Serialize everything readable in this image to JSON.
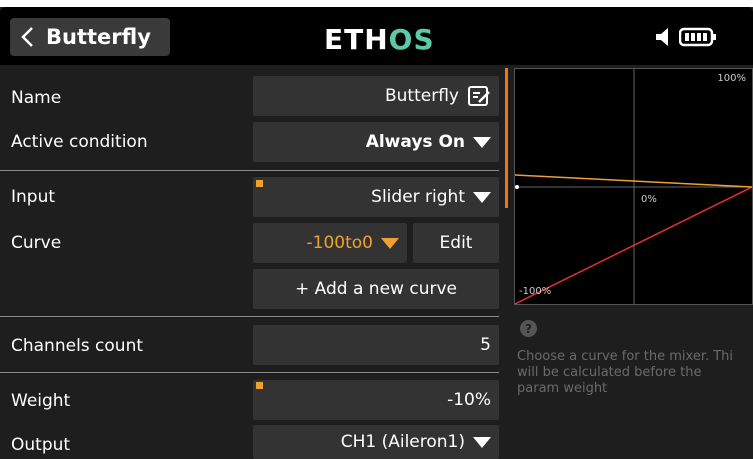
{
  "header": {
    "title": "Butterfly",
    "logo_main": "ETH",
    "logo_accent": "OS"
  },
  "rows": {
    "name": {
      "label": "Name",
      "value": "Butterfly"
    },
    "active_condition": {
      "label": "Active condition",
      "value": "Always On"
    },
    "input": {
      "label": "Input",
      "value": "Slider right"
    },
    "curve": {
      "label": "Curve",
      "value": "-100to0",
      "edit_label": "Edit",
      "add_label": "+ Add a new curve"
    },
    "channels_count": {
      "label": "Channels count",
      "value": "5"
    },
    "weight": {
      "label": "Weight",
      "value": "-10%"
    },
    "output": {
      "label": "Output",
      "value": "CH1 (Aileron1)"
    }
  },
  "graph": {
    "top_label": "100%",
    "mid_label": "0%",
    "bottom_label": "-100%"
  },
  "help": {
    "icon": "?",
    "text": "Choose a curve for the mixer. Thi\nwill be calculated before the\nparam weight"
  },
  "colors": {
    "accent_orange": "#f0a030",
    "curve_red": "#e03030",
    "logo_os": "#5ec9a8"
  }
}
